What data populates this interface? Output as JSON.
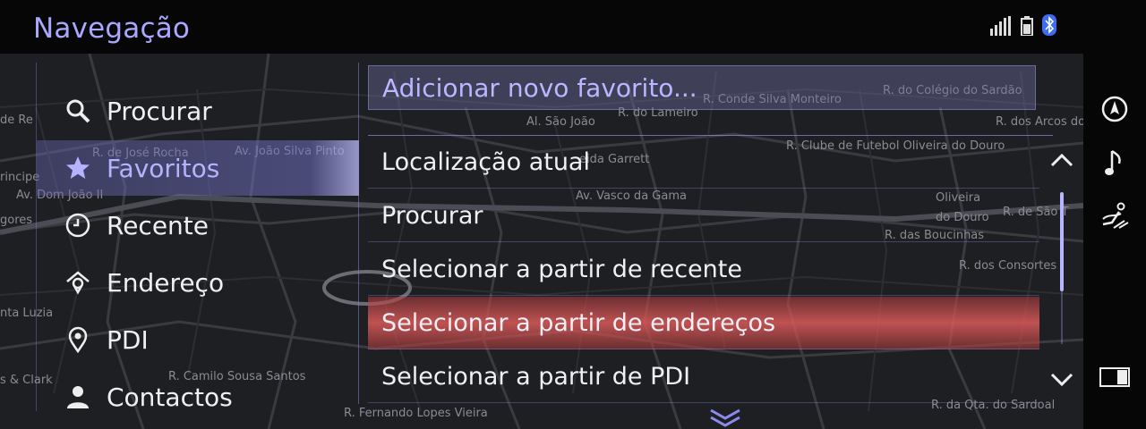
{
  "header": {
    "title": "Navegação"
  },
  "status_icons": [
    "signal-icon",
    "battery-icon",
    "bluetooth-icon"
  ],
  "map": {
    "labels": [
      {
        "text": "R. Conde Silva Monteiro"
      },
      {
        "text": "R. do Lameiro"
      },
      {
        "text": "Al. São João"
      },
      {
        "text": "R. do Colégio do Sardão"
      },
      {
        "text": "R. dos Arcos do"
      },
      {
        "text": "R. Clube de Futebol Oliveira do Douro"
      },
      {
        "text": "R. de José Rocha"
      },
      {
        "text": "Av. João Silva Pinto"
      },
      {
        "text": "Av. Dom João II"
      },
      {
        "text": "Av. Vasco da Gama"
      },
      {
        "text": "Oliveira"
      },
      {
        "text": "do Douro"
      },
      {
        "text": "R. de São T"
      },
      {
        "text": "R. das Boucinhas"
      },
      {
        "text": "R. dos Consortes"
      },
      {
        "text": "nta Luzia"
      },
      {
        "text": "s & Clark"
      },
      {
        "text": "R. Camilo Sousa Santos"
      },
      {
        "text": "R. Fernando Lopes Vieira"
      },
      {
        "text": "R. da Qta. do Sardoal"
      },
      {
        "text": "de Re"
      },
      {
        "text": "rincipe"
      },
      {
        "text": "gores"
      },
      {
        "text": "eida Garrett"
      }
    ]
  },
  "sidebar": {
    "items": [
      {
        "label": "Procurar",
        "icon": "search-icon",
        "active": false
      },
      {
        "label": "Favoritos",
        "icon": "star-icon",
        "active": true
      },
      {
        "label": "Recente",
        "icon": "clock-icon",
        "active": false
      },
      {
        "label": "Endereço",
        "icon": "home-pin-icon",
        "active": false
      },
      {
        "label": "PDI",
        "icon": "location-pin-icon",
        "active": false
      },
      {
        "label": "Contactos",
        "icon": "person-icon",
        "active": false
      }
    ]
  },
  "content": {
    "add_favorite": "Adicionar novo favorito...",
    "list": [
      {
        "label": "Localização atual"
      },
      {
        "label": "Procurar"
      },
      {
        "label": "Selecionar a partir de recente"
      },
      {
        "label": "Selecionar a partir de endereços",
        "focused": true
      },
      {
        "label": "Selecionar a partir de PDI"
      }
    ],
    "scroll": {
      "position_fraction": 0.0,
      "visible_fraction": 0.65
    }
  },
  "rightbar": {
    "buttons": [
      "navigation-icon",
      "music-note-icon",
      "seat-climate-icon",
      "screen-split-icon"
    ]
  },
  "colors": {
    "accent": "#a9a7ff",
    "focus": "#d96b6b",
    "background": "#060607"
  }
}
